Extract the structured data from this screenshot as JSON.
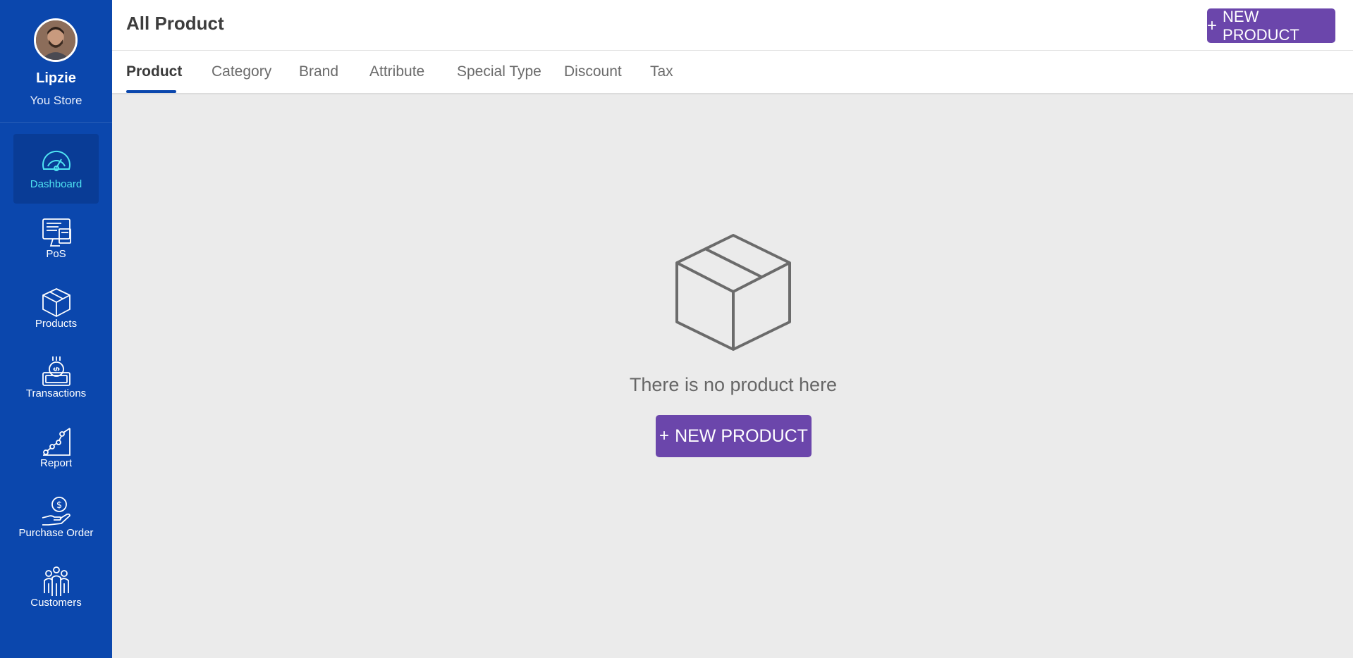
{
  "user": {
    "name": "Lipzie",
    "store": "You Store"
  },
  "sidebar": {
    "items": [
      {
        "label": "Dashboard",
        "icon": "gauge-icon",
        "active": true
      },
      {
        "label": "PoS",
        "icon": "pos-terminal-icon",
        "active": false
      },
      {
        "label": "Products",
        "icon": "box-icon",
        "active": false
      },
      {
        "label": "Transactions",
        "icon": "cash-register-icon",
        "active": false
      },
      {
        "label": "Report",
        "icon": "line-chart-icon",
        "active": false
      },
      {
        "label": "Purchase Order",
        "icon": "hand-coin-icon",
        "active": false
      },
      {
        "label": "Customers",
        "icon": "people-icon",
        "active": false
      }
    ]
  },
  "header": {
    "title": "All Product",
    "new_button": "NEW PRODUCT",
    "plus": "+"
  },
  "tabs": [
    {
      "label": "Product",
      "active": true
    },
    {
      "label": "Category",
      "active": false
    },
    {
      "label": "Brand",
      "active": false
    },
    {
      "label": "Attribute",
      "active": false
    },
    {
      "label": "Special Type",
      "active": false
    },
    {
      "label": "Discount",
      "active": false
    },
    {
      "label": "Tax",
      "active": false
    }
  ],
  "empty_state": {
    "icon": "empty-box-icon",
    "message": "There is no product here",
    "button": "NEW PRODUCT",
    "plus": "+"
  },
  "colors": {
    "sidebar": "#0b47ad",
    "sidebar_active": "#093c96",
    "accent": "#6b46ab",
    "active_label": "#4fe3f2",
    "tab_underline": "#0b47ad",
    "content_bg": "#ebebeb"
  }
}
